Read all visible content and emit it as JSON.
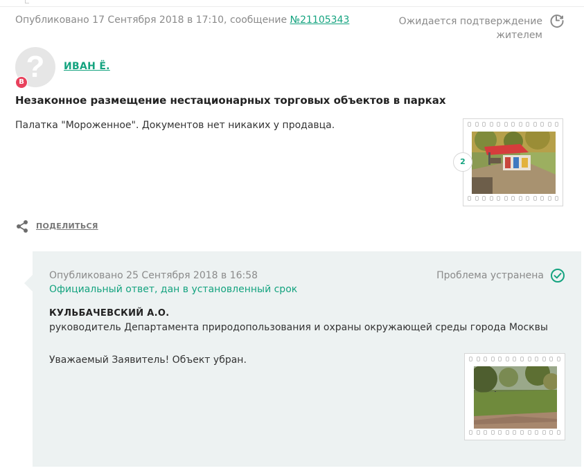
{
  "post": {
    "meta_prefix": "Опубликовано 17 Сентября 2018 в 17:10, сообщение ",
    "message_number": "№21105343",
    "status": "Ожидается подтверждение жителем",
    "author": "ИВАН Ё.",
    "badge": "В",
    "title": "Незаконное размещение нестационарных торговых объектов в парках",
    "text": "Палатка \"Мороженное\". Документов нет никаких у продавца.",
    "photo_count": "2",
    "share_label": "ПОДЕЛИТЬСЯ"
  },
  "answer": {
    "meta": "Опубликовано 25 Сентября 2018 в 16:58",
    "official": "Официальный ответ, дан в установленный срок",
    "status": "Проблема устранена",
    "author_name": "КУЛЬБАЧЕВСКИЙ А.О.",
    "author_role": "руководитель Департамента природопользования и охраны окружающей среды города Москвы",
    "text": "Уважаемый Заявитель! Объект убран."
  },
  "colors": {
    "accent": "#14a37f",
    "badge": "#e8415c",
    "answer_bg": "#edf2f2",
    "muted": "#8a8a8a"
  },
  "icons": {
    "status_pending": "clock-history-icon",
    "status_done": "check-circle-icon",
    "share": "share-icon",
    "avatar": "question-mark-avatar"
  }
}
